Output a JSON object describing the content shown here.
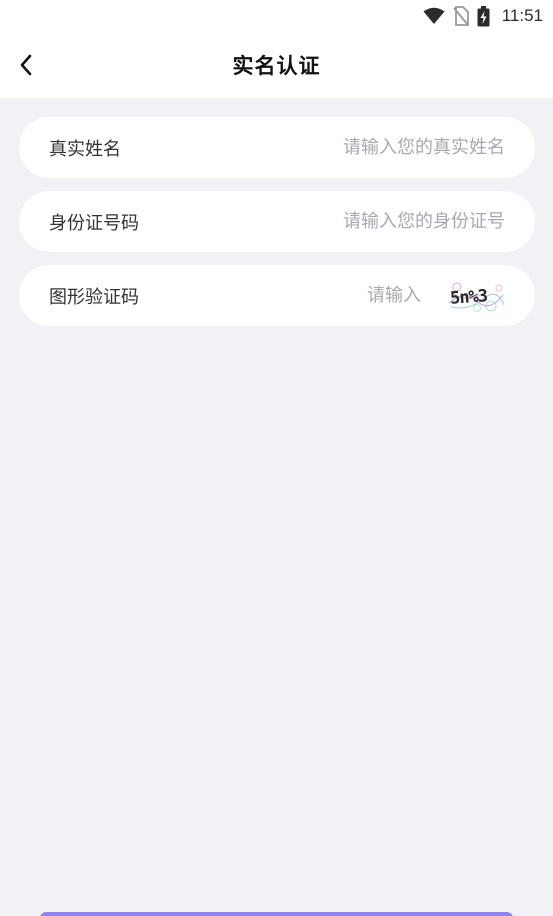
{
  "status_bar": {
    "time": "11:51",
    "icons": [
      "wifi-icon",
      "no-sim-icon",
      "battery-charging-icon"
    ]
  },
  "header": {
    "title": "实名认证",
    "back_icon": "chevron-left-icon"
  },
  "form": {
    "name_label": "真实姓名",
    "name_placeholder": "请输入您的真实姓名",
    "name_value": "",
    "id_label": "身份证号码",
    "id_placeholder": "请输入您的身份证号",
    "id_value": "",
    "captcha_label": "图形验证码",
    "captcha_placeholder": "请输入",
    "captcha_value": "",
    "captcha_image_text": "5n%3"
  },
  "colors": {
    "background": "#f2f2f6",
    "card": "#ffffff",
    "placeholder": "#a8a8ae",
    "accent": "#8f84f2"
  }
}
